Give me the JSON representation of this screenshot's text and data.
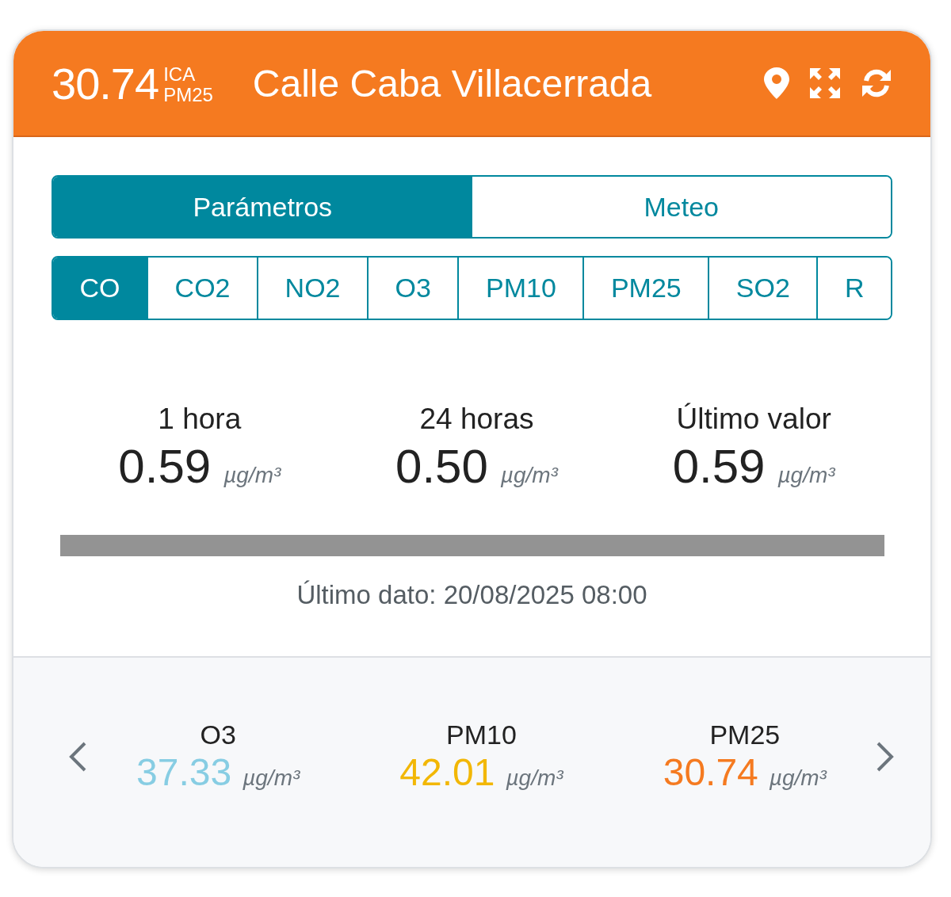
{
  "header": {
    "index_value": "30.74",
    "index_label": "ICA",
    "index_pollutant": "PM25",
    "station": "Calle Caba Villacerrada"
  },
  "view_tabs": [
    {
      "label": "Parámetros",
      "selected": true
    },
    {
      "label": "Meteo",
      "selected": false
    }
  ],
  "parameter_tabs": [
    {
      "label": "CO",
      "selected": true
    },
    {
      "label": "CO2",
      "selected": false
    },
    {
      "label": "NO2",
      "selected": false
    },
    {
      "label": "O3",
      "selected": false
    },
    {
      "label": "PM10",
      "selected": false
    },
    {
      "label": "PM25",
      "selected": false
    },
    {
      "label": "SO2",
      "selected": false
    },
    {
      "label": "R",
      "selected": false
    }
  ],
  "stats": [
    {
      "label": "1 hora",
      "value": "0.59",
      "unit": "µg/m³"
    },
    {
      "label": "24 horas",
      "value": "0.50",
      "unit": "µg/m³"
    },
    {
      "label": "Último valor",
      "value": "0.59",
      "unit": "µg/m³"
    }
  ],
  "last_update": "Último dato: 20/08/2025 08:00",
  "carousel": [
    {
      "name": "O3",
      "value": "37.33",
      "unit": "µg/m³",
      "color": "#87cde3"
    },
    {
      "name": "PM10",
      "value": "42.01",
      "unit": "µg/m³",
      "color": "#f2b705"
    },
    {
      "name": "PM25",
      "value": "30.74",
      "unit": "µg/m³",
      "color": "#f57a20"
    }
  ]
}
